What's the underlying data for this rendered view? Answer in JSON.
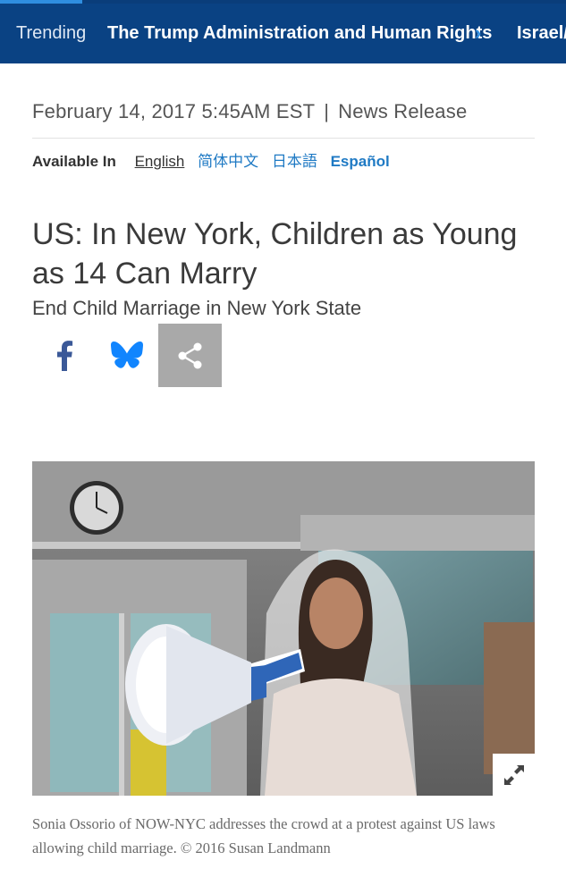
{
  "topbar": {
    "trending_label": "Trending",
    "items": [
      "The Trump Administration and Human Rights",
      "Israel/"
    ]
  },
  "article": {
    "date": "February 14, 2017 5:45AM EST",
    "separator": "|",
    "type": "News Release",
    "available_in_label": "Available In",
    "languages": [
      "English",
      "简体中文",
      "日本語",
      "Español"
    ],
    "title": "US: In New York, Children as Young as 14 Can Marry",
    "subtitle": "End Child Marriage in New York State",
    "share": {
      "icons": [
        "facebook-icon",
        "bluesky-icon",
        "share-icon"
      ]
    },
    "image": {
      "caption": "Sonia Ossorio of NOW-NYC addresses the crowd at a protest against US laws allowing child marriage. © 2016 Susan Landmann",
      "expand_icon": "expand-icon"
    }
  },
  "colors": {
    "nav_bg": "#0a4283",
    "link": "#1f7ac4",
    "share_active_bg": "#a9a9a9"
  }
}
